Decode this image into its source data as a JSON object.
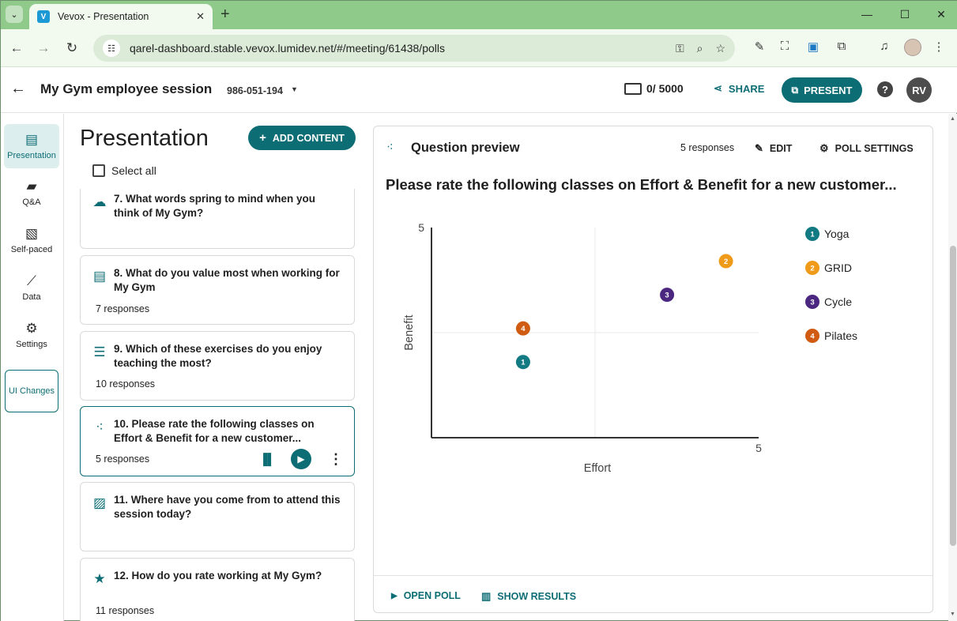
{
  "browser": {
    "tab_title": "Vevox - Presentation",
    "tab_favicon": "V",
    "url": "qarel-dashboard.stable.vevox.lumidev.net/#/meeting/61438/polls"
  },
  "header": {
    "session_title": "My Gym employee session",
    "session_code": "986-051-194",
    "devices_count": "0/ 5000",
    "share_label": "SHARE",
    "present_label": "PRESENT",
    "help_label": "?",
    "avatar_initials": "RV"
  },
  "sidebar": {
    "items": [
      {
        "label": "Presentation",
        "icon": "presentation-icon",
        "active": true
      },
      {
        "label": "Q&A",
        "icon": "qa-icon",
        "active": false
      },
      {
        "label": "Self-paced",
        "icon": "clipboard-icon",
        "active": false
      },
      {
        "label": "Data",
        "icon": "chart-line-icon",
        "active": false
      },
      {
        "label": "Settings",
        "icon": "gear-icon",
        "active": false
      }
    ],
    "ui_changes_label": "UI Changes"
  },
  "presentation": {
    "heading": "Presentation",
    "add_content_label": "ADD CONTENT",
    "select_all_label": "Select all",
    "items": [
      {
        "title": "7. What words spring to mind when you think of My Gym?",
        "responses": "",
        "icon": "cloud-icon"
      },
      {
        "title": "8. What do you value most when working for My Gym",
        "responses": "7 responses",
        "icon": "text-icon"
      },
      {
        "title": "9. Which of these exercises do you enjoy teaching the most?",
        "responses": "10 responses",
        "icon": "list-icon"
      },
      {
        "title": "10. Please rate the following classes on Effort & Benefit for a new customer...",
        "responses": "5 responses",
        "icon": "scatter-icon",
        "selected": true
      },
      {
        "title": "11. Where have you come from to attend this session today?",
        "responses": "",
        "icon": "image-icon"
      },
      {
        "title": "12. How do you rate working at My Gym?",
        "responses": "11 responses",
        "icon": "star-icon"
      }
    ]
  },
  "preview": {
    "title": "Question preview",
    "responses": "5 responses",
    "edit_label": "EDIT",
    "settings_label": "POLL SETTINGS",
    "question": "Please rate the following classes on Effort & Benefit for a new customer...",
    "open_poll_label": "OPEN POLL",
    "show_results_label": "SHOW RESULTS"
  },
  "chart_data": {
    "type": "scatter",
    "title": "",
    "xlabel": "Effort",
    "ylabel": "Benefit",
    "xlim": [
      0,
      5
    ],
    "ylim": [
      0,
      5
    ],
    "x_max_label": "5",
    "y_max_label": "5",
    "grid": "quadrant lines at midpoint",
    "legend_position": "right",
    "series": [
      {
        "id": "1",
        "name": "Yoga",
        "x": 1.4,
        "y": 1.8,
        "color": "#117a82"
      },
      {
        "id": "2",
        "name": "GRID",
        "x": 4.5,
        "y": 4.2,
        "color": "#f09a1a"
      },
      {
        "id": "3",
        "name": "Cycle",
        "x": 3.6,
        "y": 3.4,
        "color": "#4b2780"
      },
      {
        "id": "4",
        "name": "Pilates",
        "x": 1.4,
        "y": 2.6,
        "color": "#cf5c12"
      }
    ]
  }
}
